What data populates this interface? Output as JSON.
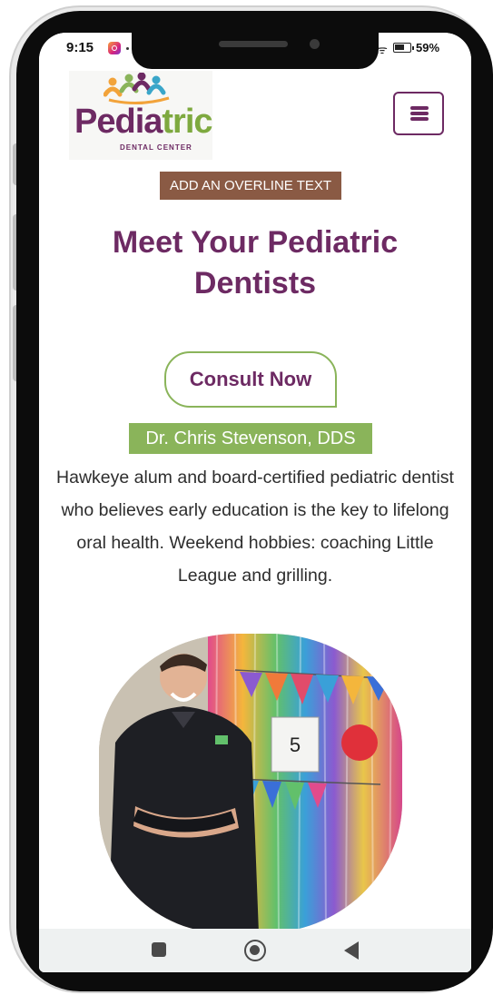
{
  "status_bar": {
    "time": "9:15",
    "battery": "59%"
  },
  "header": {
    "logo_word_a": "Pedia",
    "logo_word_b": "tric",
    "logo_subtitle": "DENTAL CENTER",
    "menu_icon": "hamburger-menu-icon"
  },
  "main": {
    "overline": "ADD AN OVERLINE TEXT",
    "title": "Meet Your Pediatric Dentists",
    "cta_label": "Consult Now",
    "doctor": {
      "name": "Dr. Chris Stevenson, DDS",
      "bio": "Hawkeye alum and board-certified pediatric dentist who believes early education is the key to lifelong oral health. Weekend hobbies: coaching Little League and grilling.",
      "photo_sign": "5"
    }
  },
  "nav_bar": {
    "icons": [
      "recent-apps-icon",
      "home-icon",
      "back-icon"
    ]
  },
  "colors": {
    "brand_purple": "#6d2a63",
    "brand_green": "#8ab45a",
    "overline_brown": "#8a5a44"
  }
}
